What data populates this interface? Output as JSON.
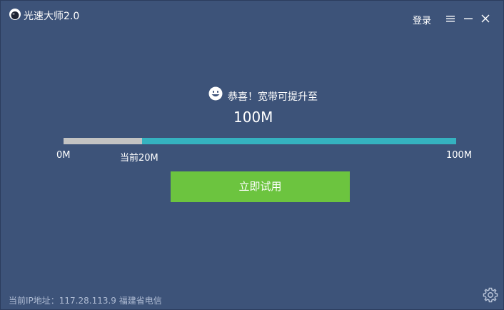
{
  "window": {
    "title": "光速大师2.0",
    "login_label": "登录"
  },
  "main": {
    "congrats_text": "恭喜！宽带可提升至",
    "target_speed": "100M",
    "progress": {
      "min_label": "0M",
      "current_label": "当前20M",
      "max_label": "100M",
      "current_fraction": 0.2
    },
    "try_button_label": "立即试用"
  },
  "status": {
    "ip_info": "当前IP地址：117.28.113.9 福建省电信"
  },
  "icons": {
    "logo": "app-logo-icon",
    "menu": "hamburger-menu-icon",
    "minimize": "minimize-icon",
    "close": "close-icon",
    "smile": "smile-icon",
    "settings": "gear-icon"
  },
  "colors": {
    "background": "#3d5379",
    "progress_fill": "#c3c3c3",
    "progress_track": "#35b2c0",
    "button": "#6cc43f",
    "status_text": "#aebbd3"
  }
}
